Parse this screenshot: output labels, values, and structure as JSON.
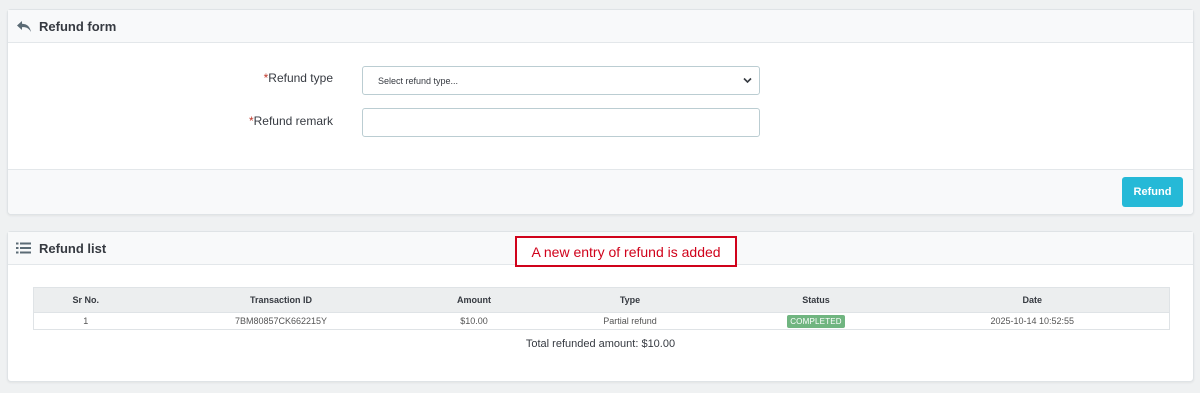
{
  "refund_form": {
    "title": "Refund form",
    "icon": "reply-arrow-icon",
    "required_mark": "*",
    "refund_type_label": "Refund type",
    "refund_type_value": "Select refund type...",
    "refund_remark_label": "Refund remark",
    "refund_remark_value": "",
    "refund_button": "Refund"
  },
  "refund_list": {
    "title": "Refund list",
    "icon": "list-icon",
    "annotation": "A new entry of refund is added",
    "columns": [
      "Sr No.",
      "Transaction ID",
      "Amount",
      "Type",
      "Status",
      "Date"
    ],
    "rows": [
      {
        "sr_no": "1",
        "transaction_id": "7BM80857CK662215Y",
        "amount": "$10.00",
        "type": "Partial refund",
        "status": "COMPLETED",
        "date": "2025-10-14 10:52:55"
      }
    ],
    "total": "Total refunded amount: $10.00"
  },
  "colors": {
    "primary_button": "#25b9d7",
    "status_completed": "#70b580",
    "annotation_red": "#d0021b",
    "required_red": "#c0392b"
  }
}
